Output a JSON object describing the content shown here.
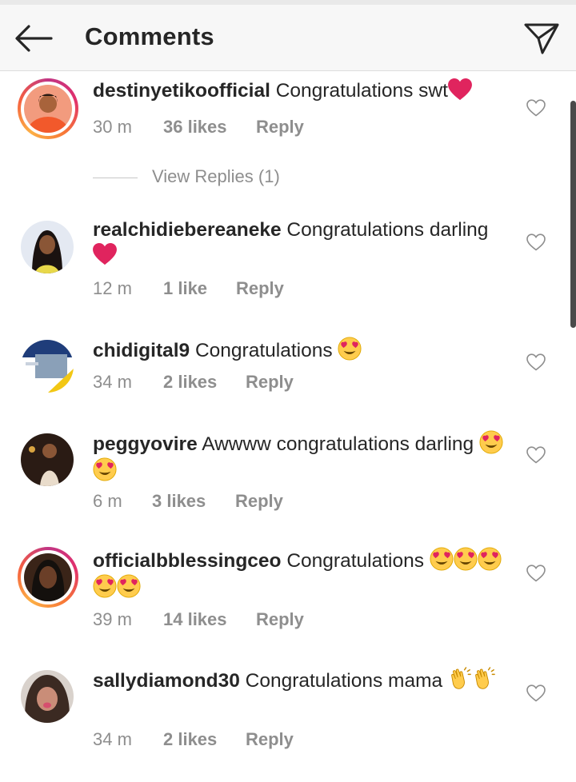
{
  "header": {
    "title": "Comments",
    "back_icon": "arrow-left-icon",
    "send_icon": "paper-plane-icon"
  },
  "comments": [
    {
      "username": "destinyetikoofficial",
      "text": "Congratulations swt",
      "emoji": "heart",
      "time": "30 m",
      "likes": "36 likes",
      "reply": "Reply",
      "story_ring": true
    },
    {
      "username": "realchidiebereaneke",
      "text": "Congratulations darling",
      "emoji": "heart",
      "time": "12 m",
      "likes": "1 like",
      "reply": "Reply",
      "story_ring": false
    },
    {
      "username": "chidigital9",
      "text": "Congratulations",
      "emoji": "heart-eyes x1",
      "time": "34 m",
      "likes": "2 likes",
      "reply": "Reply",
      "story_ring": false
    },
    {
      "username": "peggyovire",
      "text": "Awwww congratulations darling",
      "emoji": "heart-eyes x2",
      "time": "6 m",
      "likes": "3 likes",
      "reply": "Reply",
      "story_ring": false
    },
    {
      "username": "officialbblessingceo",
      "text": "Congratulations",
      "emoji": "heart-eyes x5",
      "time": "39 m",
      "likes": "14 likes",
      "reply": "Reply",
      "story_ring": true
    },
    {
      "username": "sallydiamond30",
      "text": "Congratulations mama",
      "emoji": "clapping-hands x2",
      "time": "34 m",
      "likes": "2 likes",
      "reply": "Reply",
      "story_ring": false
    }
  ],
  "view_replies": "View Replies (1)",
  "colors": {
    "text": "#262626",
    "muted": "#8e8e8e",
    "header_bg": "#f7f7f7",
    "heart_emoji": "#e0245e"
  }
}
